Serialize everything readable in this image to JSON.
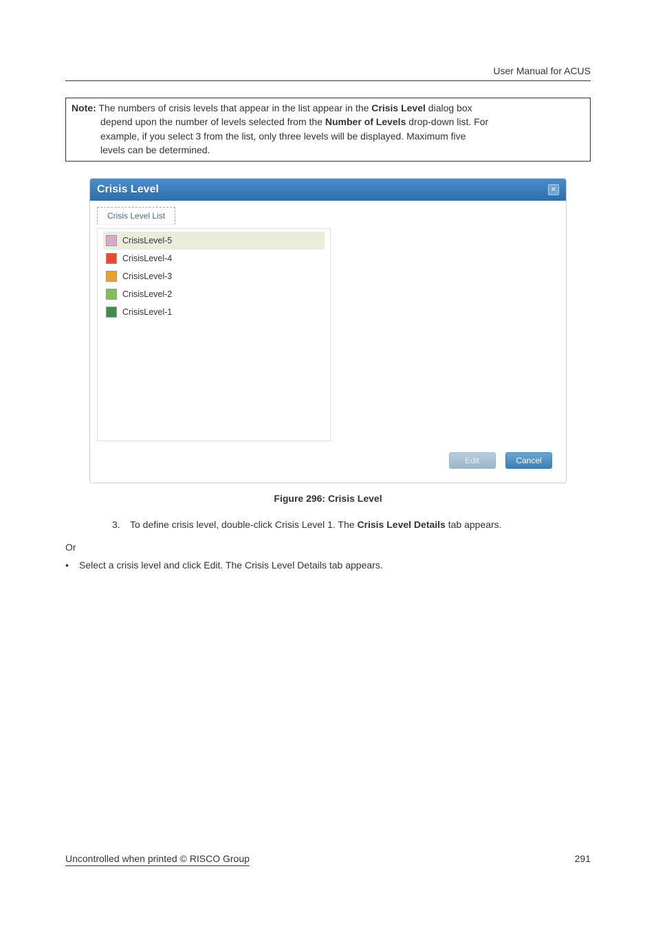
{
  "header": {
    "title": "User Manual for ACUS"
  },
  "note": {
    "label": "Note:",
    "line1a": " The numbers of crisis levels that appear in the list appear in the ",
    "line1b": "Crisis Level",
    "line1c": " dialog box",
    "line2a": "depend upon the number of levels selected from the ",
    "line2b": "Number of Levels",
    "line2c": " drop-down list. For",
    "line3": "example, if you select 3 from the list, only three levels will be displayed. Maximum five",
    "line4": "levels can be determined."
  },
  "dialog": {
    "title": "Crisis Level",
    "close": "×",
    "tab": "Crisis Level List",
    "levels": [
      {
        "name": "CrisisLevel-5",
        "color": "#d8a7c9",
        "selected": true
      },
      {
        "name": "CrisisLevel-4",
        "color": "#e84b2c",
        "selected": false
      },
      {
        "name": "CrisisLevel-3",
        "color": "#e8a12c",
        "selected": false
      },
      {
        "name": "CrisisLevel-2",
        "color": "#7fbf5a",
        "selected": false
      },
      {
        "name": "CrisisLevel-1",
        "color": "#3f8f4a",
        "selected": false
      }
    ],
    "buttons": {
      "edit": "Edit",
      "cancel": "Cancel"
    }
  },
  "figcap": "Figure 296: Crisis Level",
  "step": {
    "num": "3.",
    "a": "To define crisis level, double-click Crisis Level 1. The ",
    "b": "Crisis Level Details",
    "c": " tab appears."
  },
  "or": "Or",
  "bullet": {
    "sym": "•",
    "text": "Select a crisis level and click Edit. The Crisis Level Details tab appears."
  },
  "footer": {
    "left": "Uncontrolled when printed © RISCO Group",
    "right": "291"
  }
}
